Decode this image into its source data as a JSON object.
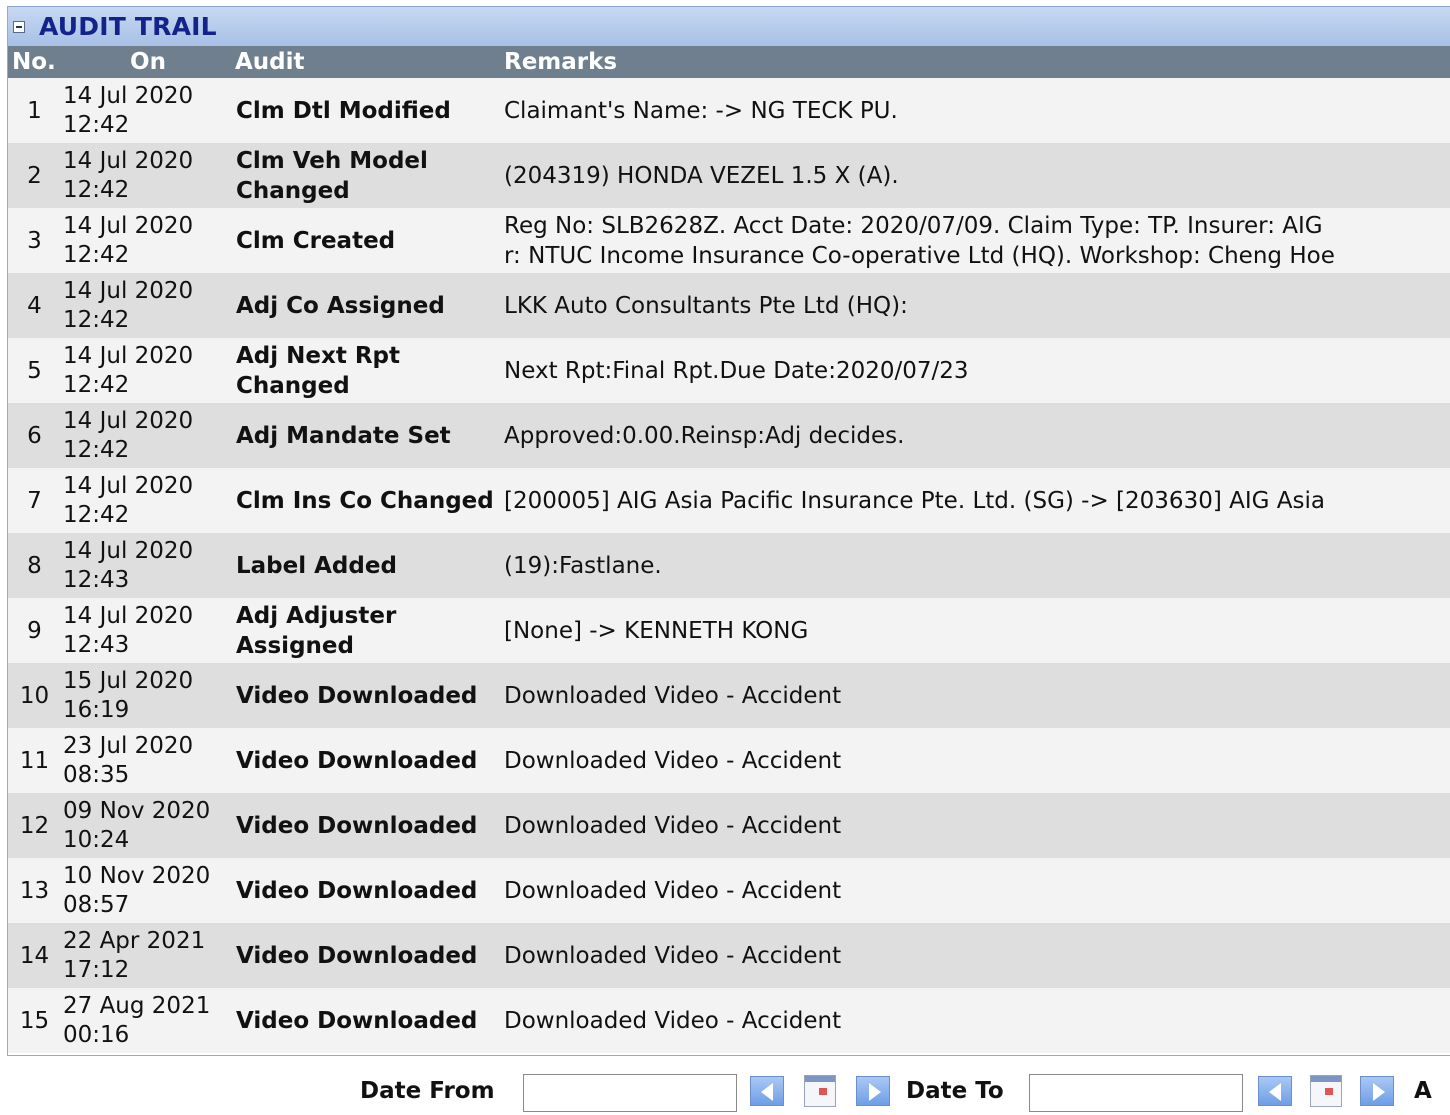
{
  "section": {
    "title": "AUDIT TRAIL"
  },
  "table": {
    "headers": {
      "no": "No.",
      "on": "On",
      "audit": "Audit",
      "remarks": "Remarks"
    },
    "rows": [
      {
        "no": "1",
        "date": "14 Jul 2020",
        "time": "12:42",
        "audit": "Clm Dtl Modified",
        "remarks": "Claimant's Name: -> NG TECK PU."
      },
      {
        "no": "2",
        "date": "14 Jul 2020",
        "time": "12:42",
        "audit": "Clm Veh Model Changed",
        "remarks": "(204319) HONDA VEZEL 1.5 X (A)."
      },
      {
        "no": "3",
        "date": "14 Jul 2020",
        "time": "12:42",
        "audit": "Clm Created",
        "remarks": "Reg No: SLB2628Z. Acct Date: 2020/07/09. Claim Type: TP. Insurer: AIG\nr: NTUC Income Insurance Co-operative Ltd (HQ). Workshop: Cheng Hoe"
      },
      {
        "no": "4",
        "date": "14 Jul 2020",
        "time": "12:42",
        "audit": "Adj Co Assigned",
        "remarks": "LKK Auto Consultants Pte Ltd (HQ):"
      },
      {
        "no": "5",
        "date": "14 Jul 2020",
        "time": "12:42",
        "audit": "Adj Next Rpt Changed",
        "remarks": "Next Rpt:Final Rpt.Due Date:2020/07/23"
      },
      {
        "no": "6",
        "date": "14 Jul 2020",
        "time": "12:42",
        "audit": "Adj Mandate Set",
        "remarks": "Approved:0.00.Reinsp:Adj decides."
      },
      {
        "no": "7",
        "date": "14 Jul 2020",
        "time": "12:42",
        "audit": "Clm Ins Co Changed",
        "remarks": "[200005] AIG Asia Pacific Insurance Pte. Ltd. (SG) -> [203630] AIG Asia"
      },
      {
        "no": "8",
        "date": "14 Jul 2020",
        "time": "12:43",
        "audit": "Label Added",
        "remarks": "(19):Fastlane."
      },
      {
        "no": "9",
        "date": "14 Jul 2020",
        "time": "12:43",
        "audit": "Adj Adjuster Assigned",
        "remarks": "[None] -> KENNETH KONG"
      },
      {
        "no": "10",
        "date": "15 Jul 2020",
        "time": "16:19",
        "audit": "Video Downloaded",
        "remarks": "Downloaded Video - Accident"
      },
      {
        "no": "11",
        "date": "23 Jul 2020",
        "time": "08:35",
        "audit": "Video Downloaded",
        "remarks": "Downloaded Video - Accident"
      },
      {
        "no": "12",
        "date": "09 Nov 2020",
        "time": "10:24",
        "audit": "Video Downloaded",
        "remarks": "Downloaded Video - Accident"
      },
      {
        "no": "13",
        "date": "10 Nov 2020",
        "time": "08:57",
        "audit": "Video Downloaded",
        "remarks": "Downloaded Video - Accident"
      },
      {
        "no": "14",
        "date": "22 Apr 2021",
        "time": "17:12",
        "audit": "Video Downloaded",
        "remarks": "Downloaded Video - Accident"
      },
      {
        "no": "15",
        "date": "27 Aug 2021",
        "time": "00:16",
        "audit": "Video Downloaded",
        "remarks": "Downloaded Video - Accident"
      }
    ]
  },
  "filter": {
    "date_from_label": "Date From",
    "date_from_value": "",
    "date_to_label": "Date To",
    "date_to_value": "",
    "truncated_label": "A"
  },
  "icons": {
    "collapse": "minus-box-icon",
    "prev": "arrow-left-icon",
    "next": "arrow-right-icon",
    "calendar": "calendar-icon"
  },
  "colors": {
    "section_title": "#13238a",
    "header_bg": "#6f7f8e",
    "row_odd": "#f3f3f3",
    "row_even": "#dedede"
  }
}
